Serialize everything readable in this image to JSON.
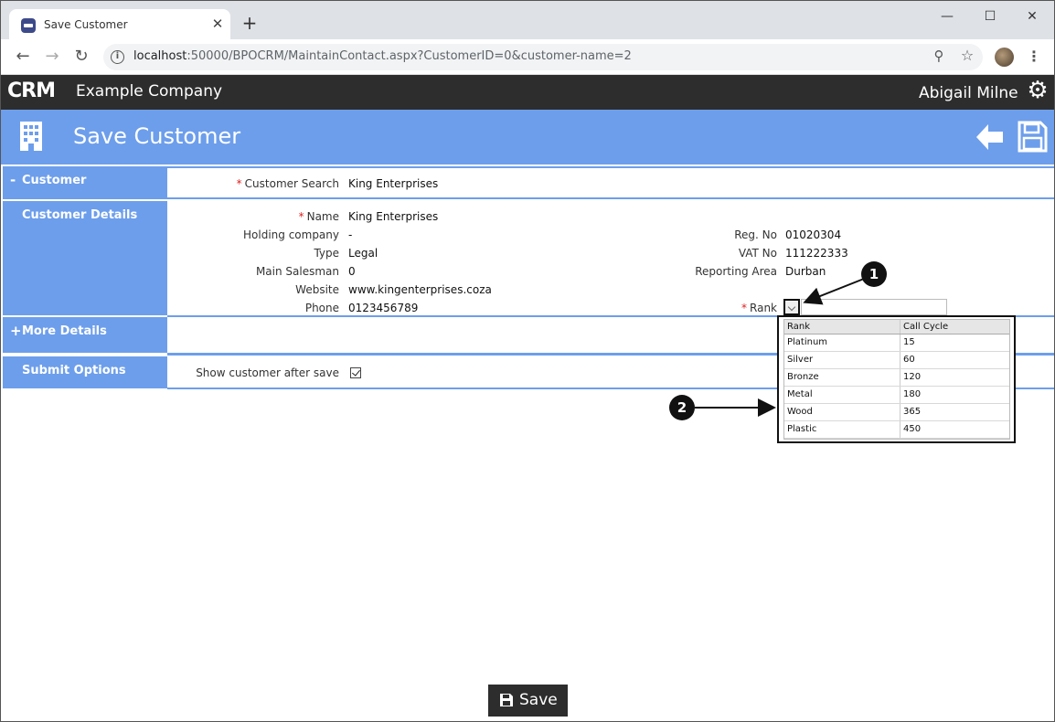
{
  "browser": {
    "tab_title": "Save Customer",
    "tab_close": "✕",
    "new_tab": "+",
    "url_host": "localhost",
    "url_rest": ":50000/BPOCRM/MaintainContact.aspx?CustomerID=0&customer-name=2",
    "minimize": "—",
    "maximize": "☐",
    "close": "✕"
  },
  "app": {
    "logo": "CRM",
    "company": "Example Company",
    "user": "Abigail Milne"
  },
  "page": {
    "title": "Save Customer"
  },
  "sections": {
    "customer": {
      "sign": "-",
      "label": "Customer"
    },
    "customer_details": {
      "label": "Customer Details"
    },
    "more_details": {
      "sign": "+",
      "label": "More Details"
    },
    "submit_options": {
      "label": "Submit Options"
    }
  },
  "customer_search": {
    "label": "Customer Search",
    "value": "King Enterprises"
  },
  "details_left": [
    {
      "label": "Name",
      "value": "King Enterprises",
      "required": "*"
    },
    {
      "label": "Holding company",
      "value": "-"
    },
    {
      "label": "Type",
      "value": "Legal"
    },
    {
      "label": "Main Salesman",
      "value": "0"
    },
    {
      "label": "Website",
      "value": "www.kingenterprises.coza"
    },
    {
      "label": "Phone",
      "value": "0123456789"
    }
  ],
  "details_right": [
    {
      "label": "Reg. No",
      "value": "01020304"
    },
    {
      "label": "VAT No",
      "value": "111222333"
    },
    {
      "label": "Reporting Area",
      "value": "Durban"
    }
  ],
  "rank": {
    "label": "Rank",
    "required": "*"
  },
  "rank_grid": {
    "headers": [
      "Rank",
      "Call Cycle"
    ],
    "rows": [
      [
        "Platinum",
        "15"
      ],
      [
        "Silver",
        "60"
      ],
      [
        "Bronze",
        "120"
      ],
      [
        "Metal",
        "180"
      ],
      [
        "Wood",
        "365"
      ],
      [
        "Plastic",
        "450"
      ]
    ]
  },
  "submit": {
    "show_after_save_label": "Show customer after save",
    "show_after_save_checked": true
  },
  "callouts": [
    "1",
    "2"
  ],
  "save_button": "Save"
}
